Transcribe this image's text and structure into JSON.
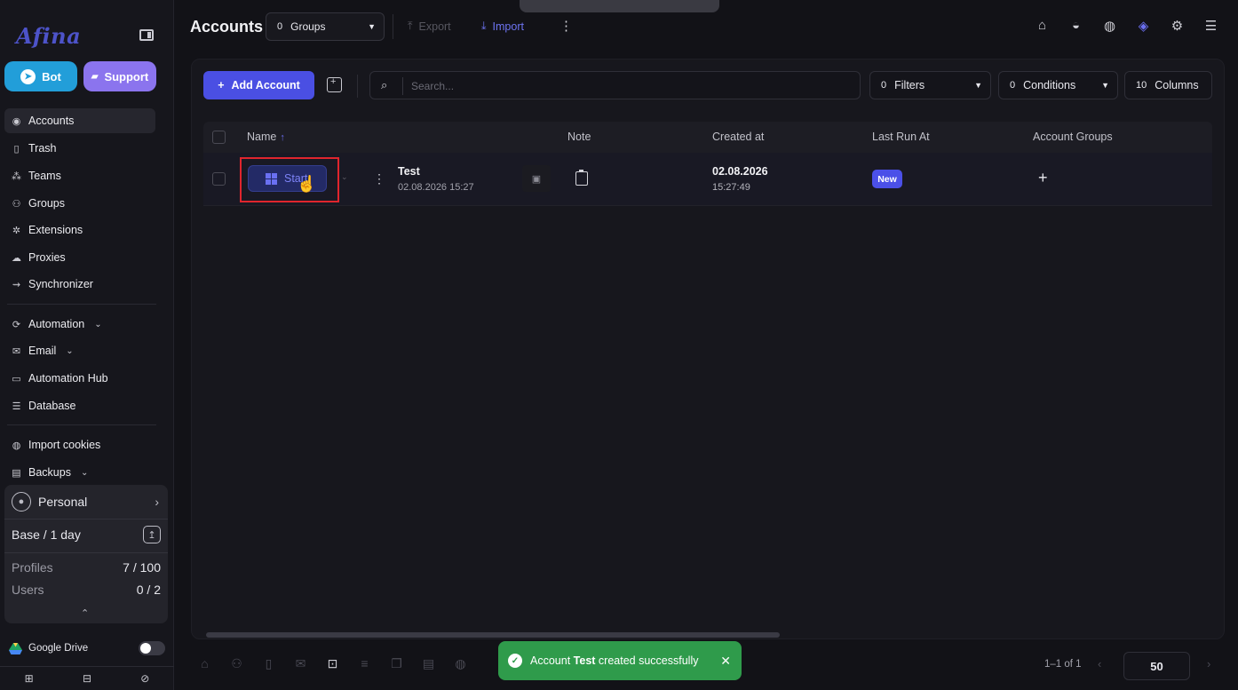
{
  "app": {
    "logo": "Afina",
    "bot_label": "Bot",
    "support_label": "Support",
    "bot_icon": "telegram-icon",
    "support_icon": "discord-icon"
  },
  "sidebar": {
    "items": [
      {
        "label": "Accounts",
        "icon": "user-circle-icon",
        "active": true
      },
      {
        "label": "Trash",
        "icon": "trash-icon"
      },
      {
        "label": "Teams",
        "icon": "team-icon"
      },
      {
        "label": "Groups",
        "icon": "users-icon"
      },
      {
        "label": "Extensions",
        "icon": "puzzle-icon"
      },
      {
        "label": "Proxies",
        "icon": "cloud-icon"
      },
      {
        "label": "Synchronizer",
        "icon": "sync-icon"
      },
      {
        "label": "Automation",
        "icon": "automation-icon",
        "expandable": true
      },
      {
        "label": "Email",
        "icon": "mail-icon",
        "expandable": true
      },
      {
        "label": "Automation Hub",
        "icon": "laptop-icon"
      },
      {
        "label": "Database",
        "icon": "list-icon"
      },
      {
        "label": "Import cookies",
        "icon": "cookie-icon"
      },
      {
        "label": "Backups",
        "icon": "backup-icon",
        "expandable": true
      }
    ]
  },
  "plan": {
    "workspace": "Personal",
    "tier": "Base / 1 day",
    "profiles_label": "Profiles",
    "profiles_value": "7 / 100",
    "users_label": "Users",
    "users_value": "0 / 2"
  },
  "google_drive": {
    "label": "Google Drive",
    "enabled": false
  },
  "header": {
    "title": "Accounts",
    "groups_count": "0",
    "groups_label": "Groups",
    "export_label": "Export",
    "import_label": "Import",
    "right_icons": [
      "tag-icon",
      "browser-icon",
      "globe-icon",
      "bot-icon",
      "settings-icon",
      "layout-icon"
    ]
  },
  "toolbar": {
    "add_label": "Add Account",
    "search_placeholder": "Search...",
    "filters_count": "0",
    "filters_label": "Filters",
    "conditions_count": "0",
    "conditions_label": "Conditions",
    "columns_count": "10",
    "columns_label": "Columns"
  },
  "table": {
    "columns": [
      "Name",
      "Note",
      "Created at",
      "Last Run At",
      "Account Groups"
    ],
    "rows": [
      {
        "start_label": "Start",
        "name": "Test",
        "name_date": "02.08.2026 15:27",
        "created_date": "02.08.2026",
        "created_time": "15:27:49",
        "last_run": "New"
      }
    ]
  },
  "toast": {
    "prefix": "Account",
    "name": "Test",
    "suffix": "created successfully"
  },
  "pagination": {
    "info": "1–1 of 1",
    "page_size": "50"
  },
  "colors": {
    "accent": "#4a4fe3",
    "success": "#2f9b4b",
    "highlight": "#e0252d"
  }
}
